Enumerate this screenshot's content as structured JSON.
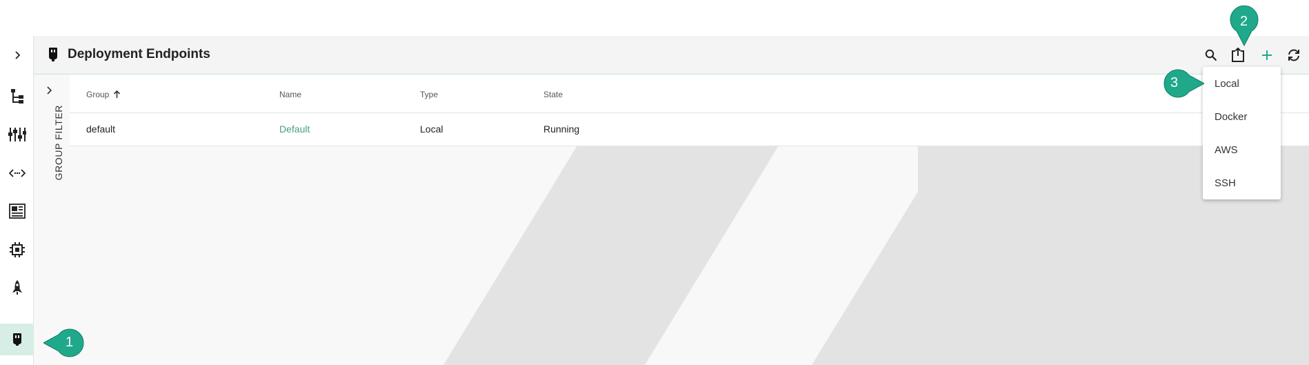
{
  "header": {
    "title": "Deployment Endpoints",
    "tools": [
      "search-icon",
      "export-icon",
      "add-icon",
      "refresh-icon"
    ]
  },
  "rail": {
    "items": [
      "expand-icon",
      "tree-icon",
      "sliders-icon",
      "code-icon",
      "document-icon",
      "chip-icon",
      "rocket-icon",
      "endpoint-icon"
    ],
    "active": "endpoint-icon"
  },
  "filter": {
    "label": "GROUP FILTER"
  },
  "table": {
    "columns": [
      "Group",
      "Name",
      "Type",
      "State"
    ],
    "sort_column": "Group",
    "rows": [
      {
        "group": "default",
        "name": "Default",
        "type": "Local",
        "state": "Running"
      }
    ]
  },
  "dropdown": {
    "items": [
      "Local",
      "Docker",
      "AWS",
      "SSH"
    ]
  },
  "callouts": [
    "1",
    "2",
    "3"
  ],
  "colors": {
    "accent": "#4a9e7a",
    "callout": "#1fa98a",
    "active_bg": "#d6eee6",
    "delete": "#3a9d74"
  }
}
